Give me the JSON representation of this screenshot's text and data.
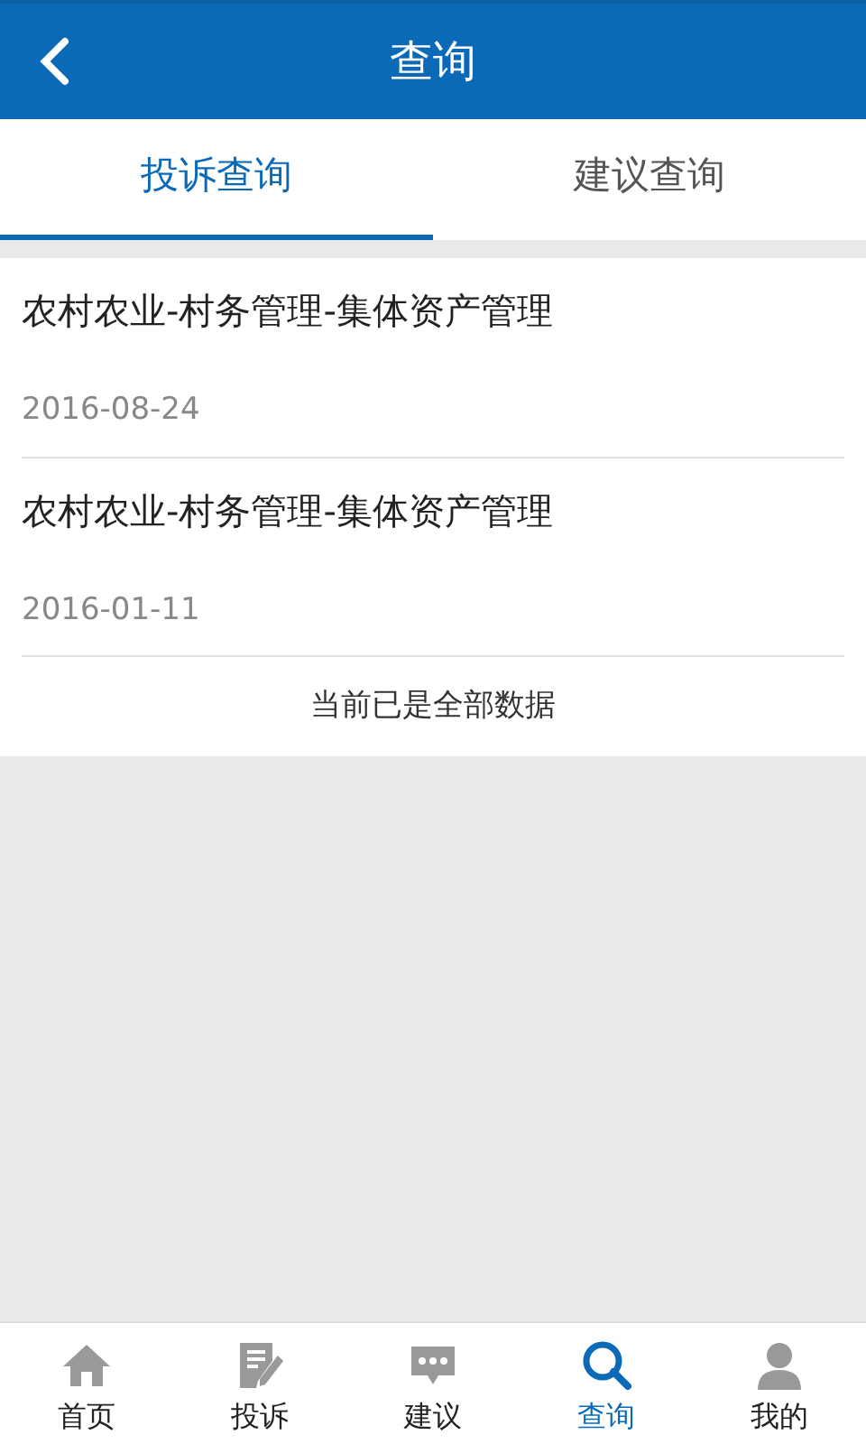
{
  "header": {
    "title": "查询"
  },
  "tabs": [
    {
      "label": "投诉查询",
      "selected": true
    },
    {
      "label": "建议查询",
      "selected": false
    }
  ],
  "items": [
    {
      "title": "农村农业-村务管理-集体资产管理",
      "date": "2016-08-24"
    },
    {
      "title": "农村农业-村务管理-集体资产管理",
      "date": "2016-01-11"
    }
  ],
  "footer_note": "当前已是全部数据",
  "bottom_nav": [
    {
      "kind": "home",
      "label": "首页",
      "selected": false
    },
    {
      "kind": "edit",
      "label": "投诉",
      "selected": false
    },
    {
      "kind": "chat",
      "label": "建议",
      "selected": false
    },
    {
      "kind": "search",
      "label": "查询",
      "selected": true
    },
    {
      "kind": "person",
      "label": "我的",
      "selected": false
    }
  ]
}
